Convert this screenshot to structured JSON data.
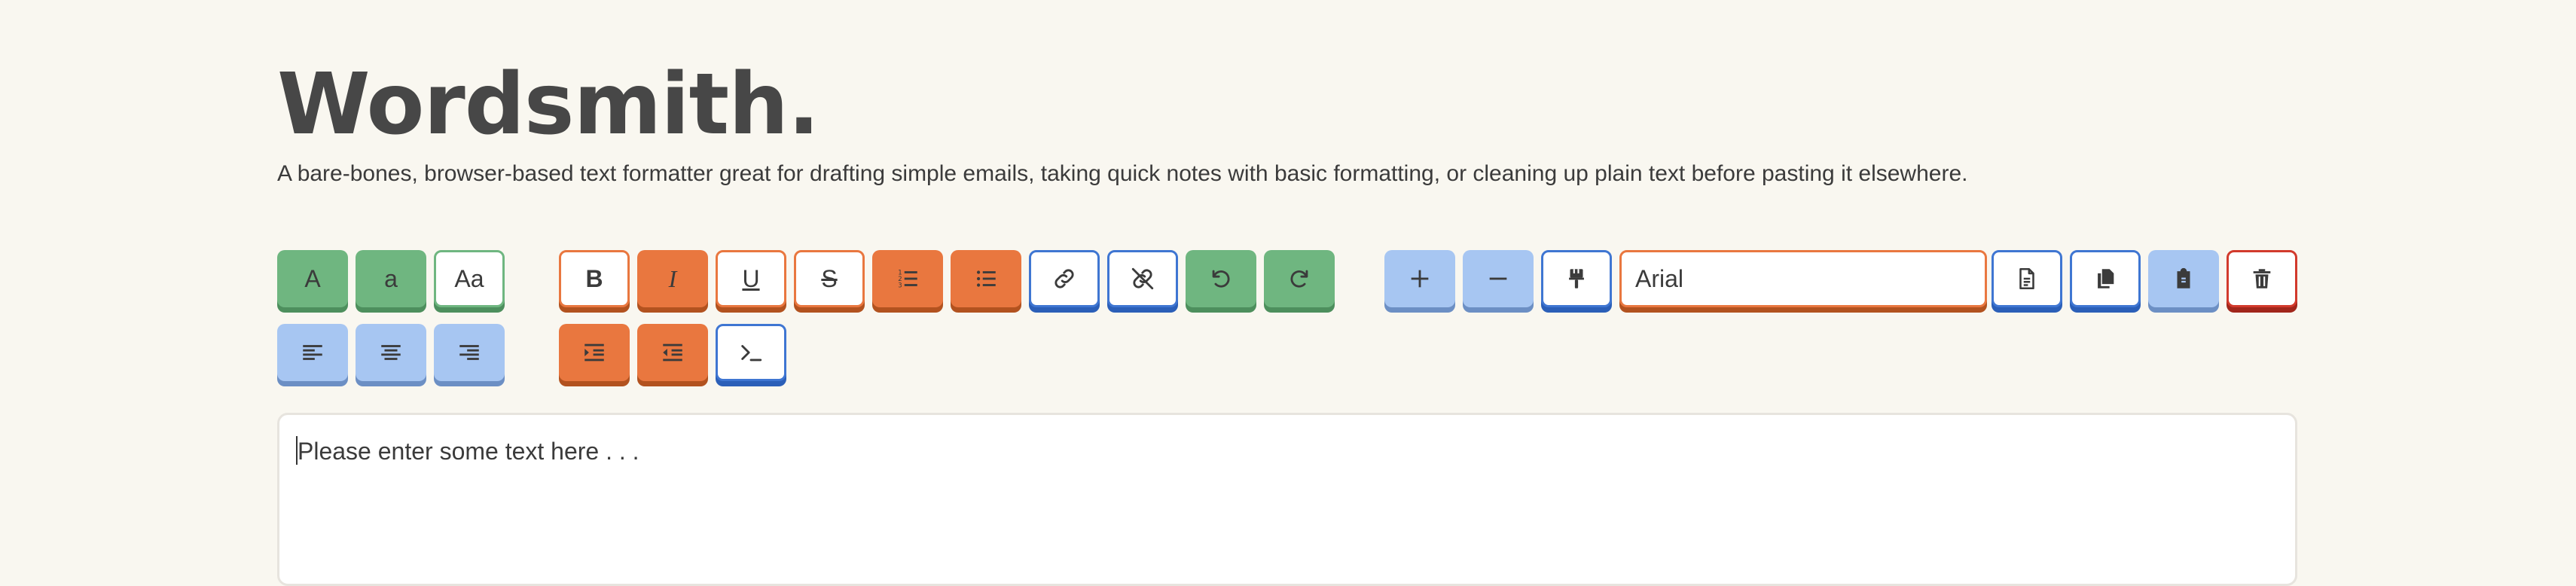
{
  "app": {
    "title": "Wordsmith.",
    "description": "A bare-bones, browser-based text formatter great for drafting simple emails, taking quick notes with basic formatting, or cleaning up plain text before pasting it elsewhere."
  },
  "toolbar": {
    "case_upper_label": "A",
    "case_lower_label": "a",
    "case_title_label": "Aa",
    "bold_label": "B",
    "italic_label": "I",
    "underline_label": "U",
    "strikethrough_label": "S",
    "font_family_value": "Arial"
  },
  "editor": {
    "placeholder": "Please enter some text here . . ."
  },
  "icons": {
    "align_left": "align-left-icon",
    "align_center": "align-center-icon",
    "align_right": "align-right-icon",
    "ordered_list": "ordered-list-icon",
    "unordered_list": "unordered-list-icon",
    "link": "link-icon",
    "unlink": "unlink-icon",
    "undo": "undo-icon",
    "redo": "redo-icon",
    "indent": "indent-icon",
    "outdent": "outdent-icon",
    "code": "terminal-icon",
    "increase_size": "plus-icon",
    "decrease_size": "minus-icon",
    "format_painter": "paint-brush-icon",
    "new_document": "document-icon",
    "copy": "copy-icon",
    "paste": "clipboard-icon",
    "delete": "trash-icon"
  },
  "colors": {
    "background": "#f9f7f0",
    "green": "#6fb680",
    "orange": "#e9773f",
    "light_blue": "#a7c6f2",
    "blue": "#3f76d2",
    "red": "#d23a2c"
  }
}
